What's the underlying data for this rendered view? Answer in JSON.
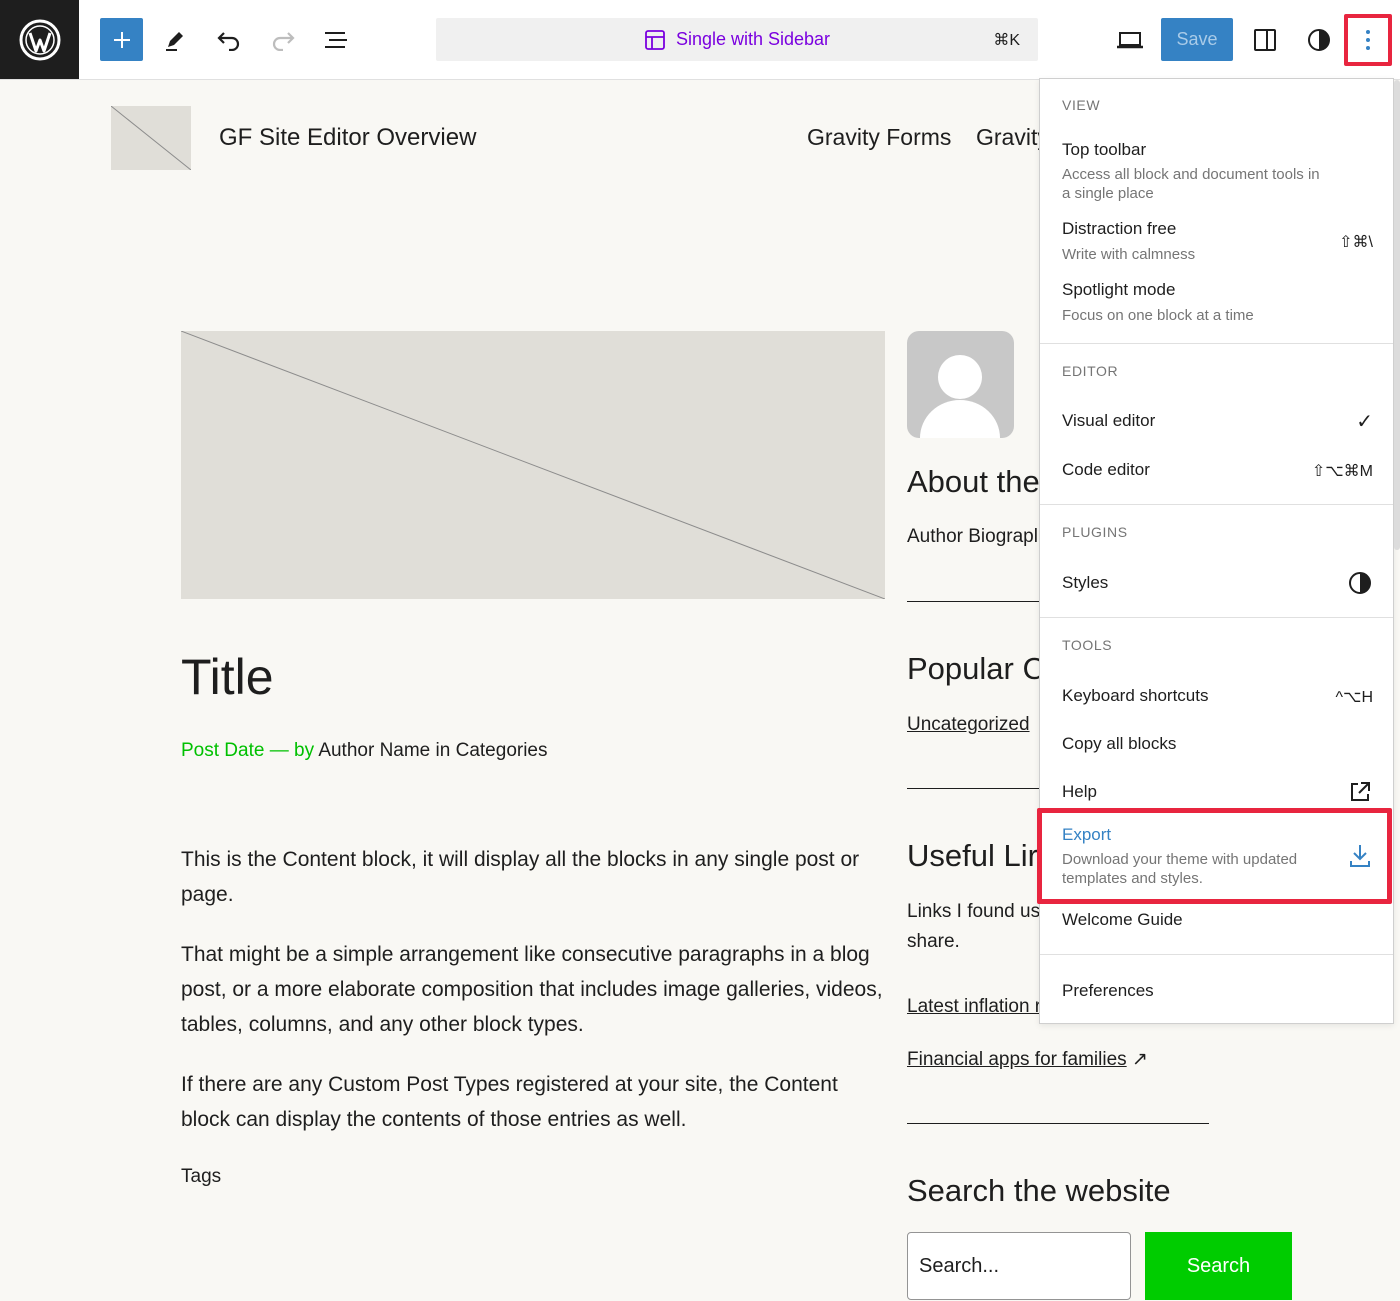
{
  "toolbar": {
    "template_title": "Single with Sidebar",
    "command_shortcut": "⌘K",
    "save_label": "Save"
  },
  "site": {
    "title": "GF Site Editor Overview",
    "nav": [
      "Gravity Forms",
      "Gravity"
    ]
  },
  "post": {
    "title": "Title",
    "date": "Post Date",
    "dash": "—",
    "by": "by",
    "author": "Author Name",
    "in_categories": "in Categories",
    "paragraphs": [
      "This is the Content block, it will display all the blocks in any single post or page.",
      "That might be a simple arrangement like consecutive paragraphs in a blog post, or a more elaborate composition that includes image galleries, videos, tables, columns, and any other block types.",
      "If there are any Custom Post Types registered at your site, the Content block can display the contents of those entries as well."
    ],
    "tags": "Tags"
  },
  "sidebar": {
    "about_heading": "About the",
    "author_bio": "Author Biograpl",
    "popular_heading": "Popular C",
    "category_link": "Uncategorized",
    "useful_heading": "Useful Lir",
    "links_intro_1": "Links I found us",
    "links_intro_2": "share.",
    "link_1": "Latest inflation r",
    "link_2": "Financial apps for families",
    "link_arrow": "↗",
    "search_heading": "Search the website",
    "search_placeholder": "Search...",
    "search_button": "Search"
  },
  "menu": {
    "view_title": "VIEW",
    "top_toolbar": "Top toolbar",
    "top_toolbar_desc": "Access all block and document tools in a single place",
    "distraction_free": "Distraction free",
    "distraction_free_desc": "Write with calmness",
    "distraction_free_kbd": "⇧⌘\\",
    "spotlight": "Spotlight mode",
    "spotlight_desc": "Focus on one block at a time",
    "editor_title": "EDITOR",
    "visual_editor": "Visual editor",
    "visual_check": "✓",
    "code_editor": "Code editor",
    "code_editor_kbd": "⇧⌥⌘M",
    "plugins_title": "PLUGINS",
    "styles": "Styles",
    "tools_title": "TOOLS",
    "keyboard_shortcuts": "Keyboard shortcuts",
    "keyboard_shortcuts_kbd": "^⌥H",
    "copy_all_blocks": "Copy all blocks",
    "help": "Help",
    "export": "Export",
    "export_desc": "Download your theme with updated templates and styles.",
    "welcome_guide": "Welcome Guide",
    "preferences": "Preferences"
  },
  "colors": {
    "accent": "#3582c4",
    "highlight": "#e8253f",
    "green": "#00c000",
    "purple": "#7a00df"
  }
}
